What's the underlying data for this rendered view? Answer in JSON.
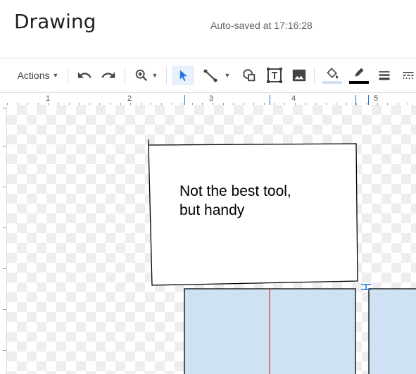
{
  "header": {
    "title": "Drawing",
    "autosave": "Auto-saved at 17:16:28"
  },
  "toolbar": {
    "actions_label": "Actions",
    "tools": [
      "undo-icon",
      "redo-icon",
      "zoom-icon",
      "select-icon",
      "line-icon",
      "shape-icon",
      "textbox-icon",
      "image-icon",
      "fill-color-icon",
      "line-color-icon",
      "line-weight-icon",
      "line-dash-icon"
    ]
  },
  "ruler": {
    "top_labels": [
      "1",
      "2",
      "3",
      "4",
      "5"
    ]
  },
  "canvas": {
    "textbox_line1": "Not the best tool,",
    "textbox_line2": "but handy",
    "shape_fill": "#cfe2f3",
    "guide_color": "#e53935",
    "handle_color": "#1a73e8"
  }
}
